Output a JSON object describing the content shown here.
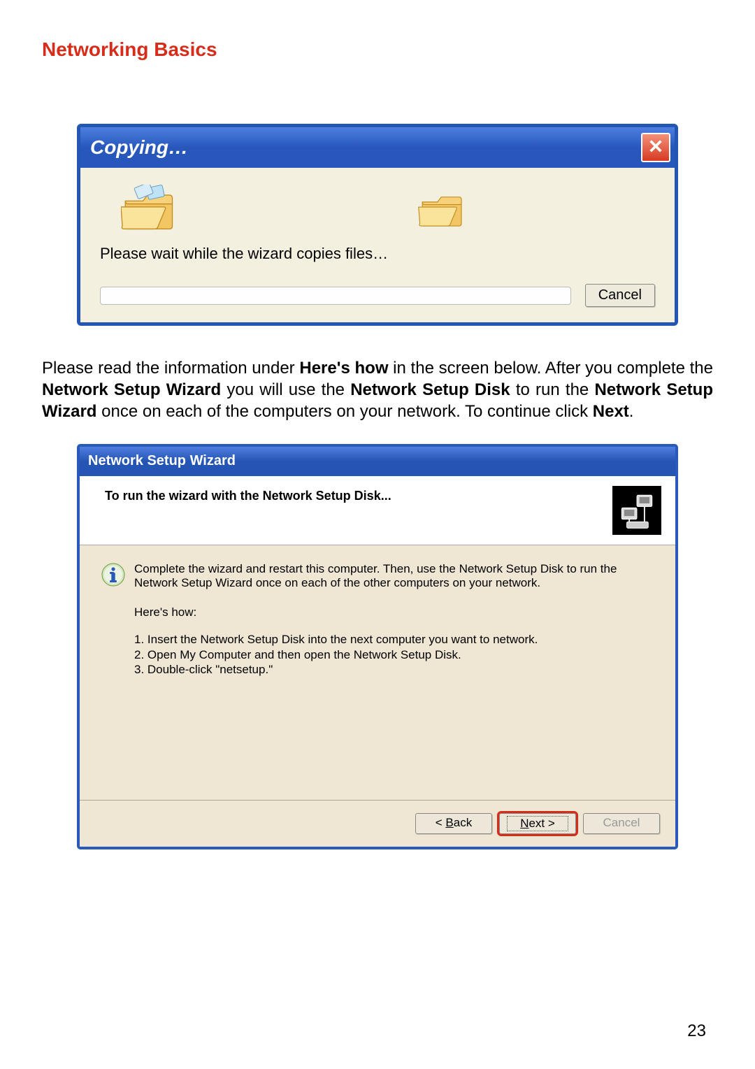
{
  "page": {
    "title": "Networking Basics",
    "number": "23"
  },
  "dialog1": {
    "title": "Copying…",
    "message": "Please wait while the wizard copies files…",
    "cancel": "Cancel"
  },
  "paragraph": {
    "p1a": "Please read the information under ",
    "p1b_bold": "Here's how",
    "p1c": " in the screen below.  After you complete the ",
    "p1d_bold": "Network Setup Wizard",
    "p1e": " you will use the ",
    "p1f_bold": "Network Setup Disk",
    "p1g": " to run the ",
    "p1h_bold": "Network Setup Wizard",
    "p1i": " once on each of the computers on your network.  To continue click ",
    "p1j_bold": "Next",
    "p1k": "."
  },
  "dialog2": {
    "title": "Network Setup Wizard",
    "header": "To run the wizard with the Network Setup Disk...",
    "info": "Complete the wizard and restart this computer. Then, use the Network Setup Disk to run the Network Setup Wizard once on each of the other computers on your network.",
    "hereshow": "Here's how:",
    "step1": "1.  Insert the Network Setup Disk into the next computer you want to network.",
    "step2": "2.  Open My Computer and then open the Network Setup Disk.",
    "step3": "3.  Double-click \"netsetup.\"",
    "back_prefix": "< ",
    "back_u": "B",
    "back_suffix": "ack",
    "next_u": "N",
    "next_suffix": "ext >",
    "cancel": "Cancel"
  }
}
